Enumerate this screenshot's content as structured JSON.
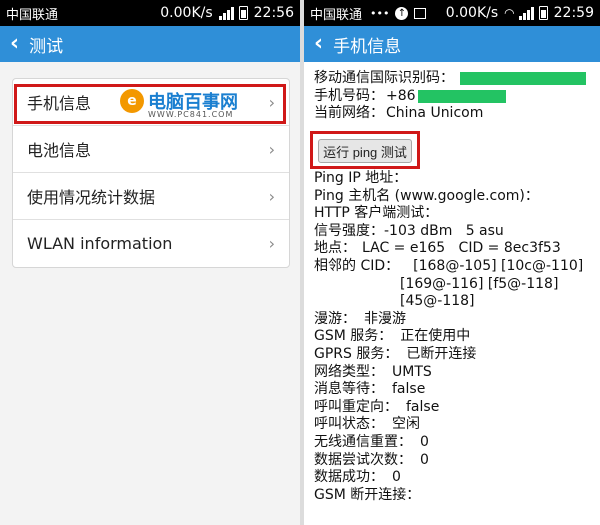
{
  "left": {
    "status": {
      "carrier": "中国联通",
      "speed": "0.00K/s",
      "time": "22:56"
    },
    "title": "测试",
    "menu": [
      {
        "label": "手机信息"
      },
      {
        "label": "电池信息"
      },
      {
        "label": "使用情况统计数据"
      },
      {
        "label": "WLAN information"
      }
    ],
    "watermark": {
      "logo": "e",
      "text": "电脑百事网",
      "url": "WWW.PC841.COM"
    }
  },
  "right": {
    "status": {
      "carrier": "中国联通",
      "speed": "0.00K/s",
      "time": "22:59"
    },
    "title": "手机信息",
    "top_rows": [
      {
        "label": "移动通信国际识别码：",
        "redacted": true
      },
      {
        "label": "手机号码：",
        "value": "+86",
        "redacted": true
      },
      {
        "label": "当前网络：",
        "value": "China Unicom"
      }
    ],
    "ping_button": "运行 ping 测试",
    "rows": [
      {
        "label": "Ping IP 地址：",
        "value": ""
      },
      {
        "label": "Ping 主机名 (www.google.com)：",
        "value": ""
      },
      {
        "label": "HTTP 客户端测试：",
        "value": ""
      },
      {
        "label": "信号强度：",
        "value": "-103 dBm   5 asu"
      },
      {
        "label": "地点：",
        "value": "LAC = e165   CID = 8ec3f53"
      },
      {
        "label": "相邻的 CID：",
        "value": "[168@-105] [10c@-110]"
      },
      {
        "label": "",
        "value": "[169@-116] [f5@-118]"
      },
      {
        "label": "",
        "value": "[45@-118]"
      },
      {
        "label": "漫游：",
        "value": "非漫游"
      },
      {
        "label": "GSM 服务：",
        "value": "正在使用中"
      },
      {
        "label": "GPRS 服务：",
        "value": "已断开连接"
      },
      {
        "label": "网络类型：",
        "value": "UMTS"
      },
      {
        "label": "消息等待：",
        "value": "false"
      },
      {
        "label": "呼叫重定向：",
        "value": "false"
      },
      {
        "label": "呼叫状态：",
        "value": "空闲"
      },
      {
        "label": "无线通信重置：",
        "value": "0"
      },
      {
        "label": "数据尝试次数：",
        "value": "0"
      },
      {
        "label": "数据成功：",
        "value": "0"
      },
      {
        "label": "GSM 断开连接：",
        "value": ""
      }
    ]
  },
  "colors": {
    "accent": "#2f8fd8",
    "highlight": "#d01818",
    "redaction": "#23c363"
  }
}
